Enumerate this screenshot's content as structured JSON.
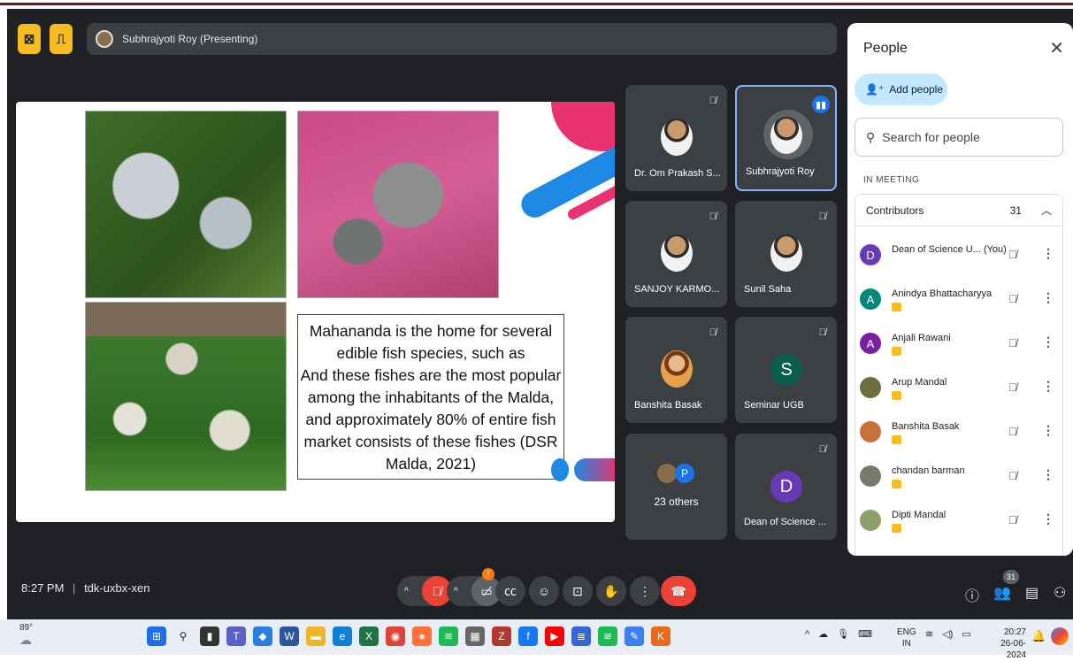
{
  "presenter": {
    "label": "Subhrajyoti Roy (Presenting)"
  },
  "slide": {
    "text": "Mahananda is the home for several edible fish species, such as\nAnd these fishes are the most popular among the inhabitants of the Malda, and  approximately 80% of entire fish market consists of these fishes (DSR Malda, 2021)"
  },
  "tiles": [
    {
      "name": "Dr. Om Prakash S...",
      "muted": true
    },
    {
      "name": "Subhrajyoti Roy",
      "speaking": true
    },
    {
      "name": "SANJOY KARMO...",
      "muted": true
    },
    {
      "name": "Sunil Saha",
      "muted": true
    },
    {
      "name": "Banshita Basak",
      "muted": true
    },
    {
      "name": "Seminar UGB",
      "initial": "S",
      "color": "#0b5e4f",
      "muted": true
    },
    {
      "name": "23 others",
      "initial": "P",
      "color": "#1a73e8"
    },
    {
      "name": "Dean of Science ...",
      "initial": "D",
      "color": "#673ab7",
      "muted": true
    }
  ],
  "people": {
    "title": "People",
    "add_label": "Add people",
    "search_placeholder": "Search for people",
    "section": "IN MEETING",
    "group_label": "Contributors",
    "group_count": "31",
    "list": [
      {
        "name": "Dean of Science U... (You)",
        "initial": "D",
        "color": "#673ab7"
      },
      {
        "name": "Anindya Bhattacharyya",
        "initial": "A",
        "color": "#00897b"
      },
      {
        "name": "Anjali Rawani",
        "initial": "A",
        "color": "#7b1fa2"
      },
      {
        "name": "Arup Mandal",
        "initial": "",
        "color": "#6d6d3f"
      },
      {
        "name": "Banshita Basak",
        "initial": "",
        "color": "#c8703a"
      },
      {
        "name": "chandan barman",
        "initial": "",
        "color": "#7a7a6a"
      },
      {
        "name": "Dipti Mandal",
        "initial": "",
        "color": "#8ca06a"
      }
    ]
  },
  "meeting": {
    "time": "8:27 PM",
    "code": "tdk-uxbx-xen",
    "participant_count": "31",
    "notification": "!"
  },
  "taskbar": {
    "temp": "89°",
    "lang1": "ENG",
    "lang2": "IN",
    "time": "20:27",
    "date": "26-06-2024"
  }
}
